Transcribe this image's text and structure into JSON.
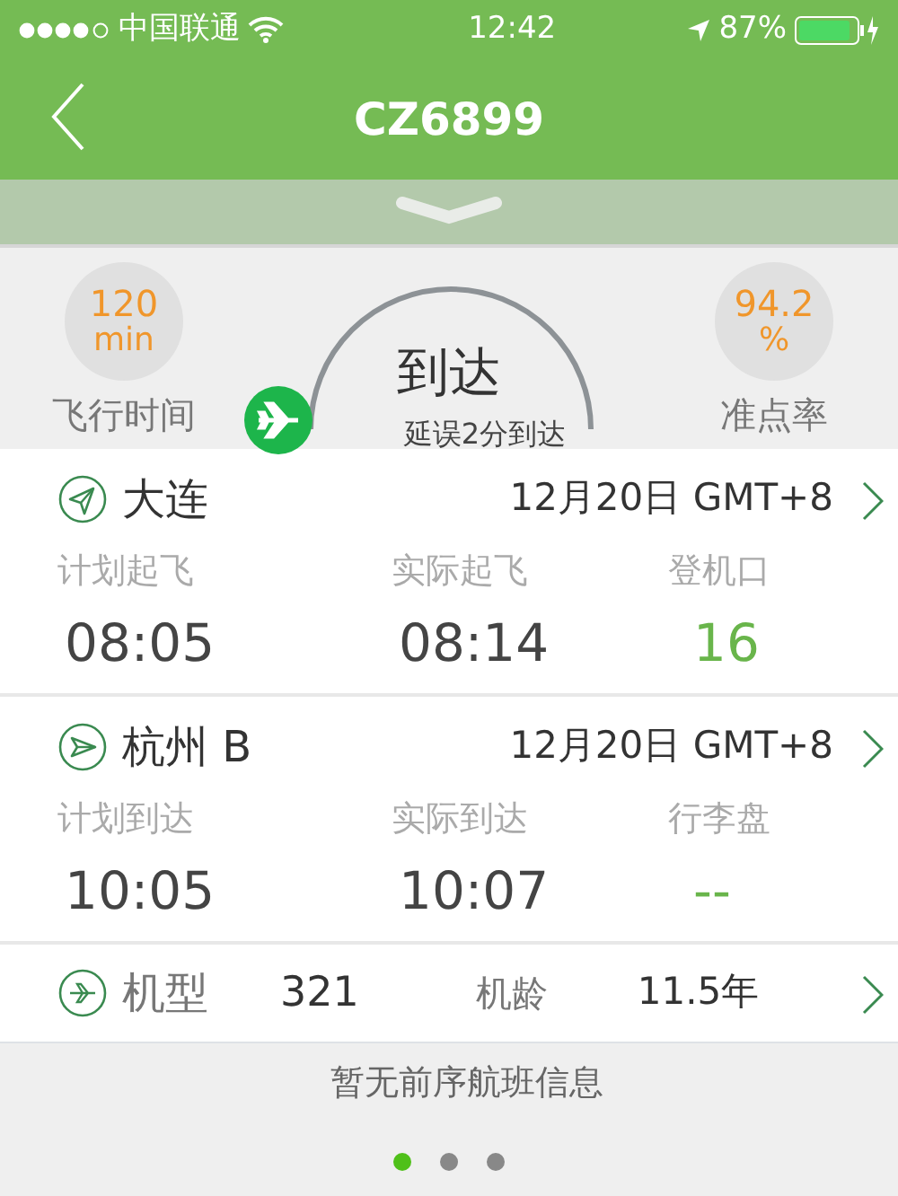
{
  "status_bar": {
    "carrier": "中国联通",
    "time": "12:42",
    "battery_text": "87%"
  },
  "nav": {
    "title": "CZ6899"
  },
  "summary": {
    "duration": {
      "value": "120",
      "unit": "min",
      "label": "飞行时间"
    },
    "status": "到达",
    "status_note": "延误2分到达",
    "on_time": {
      "value": "94.2",
      "unit": "%",
      "label": "准点率"
    }
  },
  "legs": [
    {
      "kind": "departure",
      "city": "大连",
      "date": "12月20日 GMT+8",
      "fields": [
        {
          "label": "计划起飞",
          "value": "08:05",
          "highlight": false
        },
        {
          "label": "实际起飞",
          "value": "08:14",
          "highlight": false
        },
        {
          "label": "登机口",
          "value": "16",
          "highlight": true
        }
      ]
    },
    {
      "kind": "arrival",
      "city": "杭州 B",
      "date": "12月20日 GMT+8",
      "fields": [
        {
          "label": "计划到达",
          "value": "10:05",
          "highlight": false
        },
        {
          "label": "实际到达",
          "value": "10:07",
          "highlight": false
        },
        {
          "label": "行李盘",
          "value": "--",
          "highlight": true
        }
      ]
    }
  ],
  "aircraft": {
    "type_label": "机型",
    "type_value": "321",
    "age_label": "机龄",
    "age_value": "11.5年"
  },
  "previous_flight": "暂无前序航班信息",
  "pages": [
    {
      "selected": true
    },
    {
      "selected": false
    },
    {
      "selected": false
    }
  ]
}
